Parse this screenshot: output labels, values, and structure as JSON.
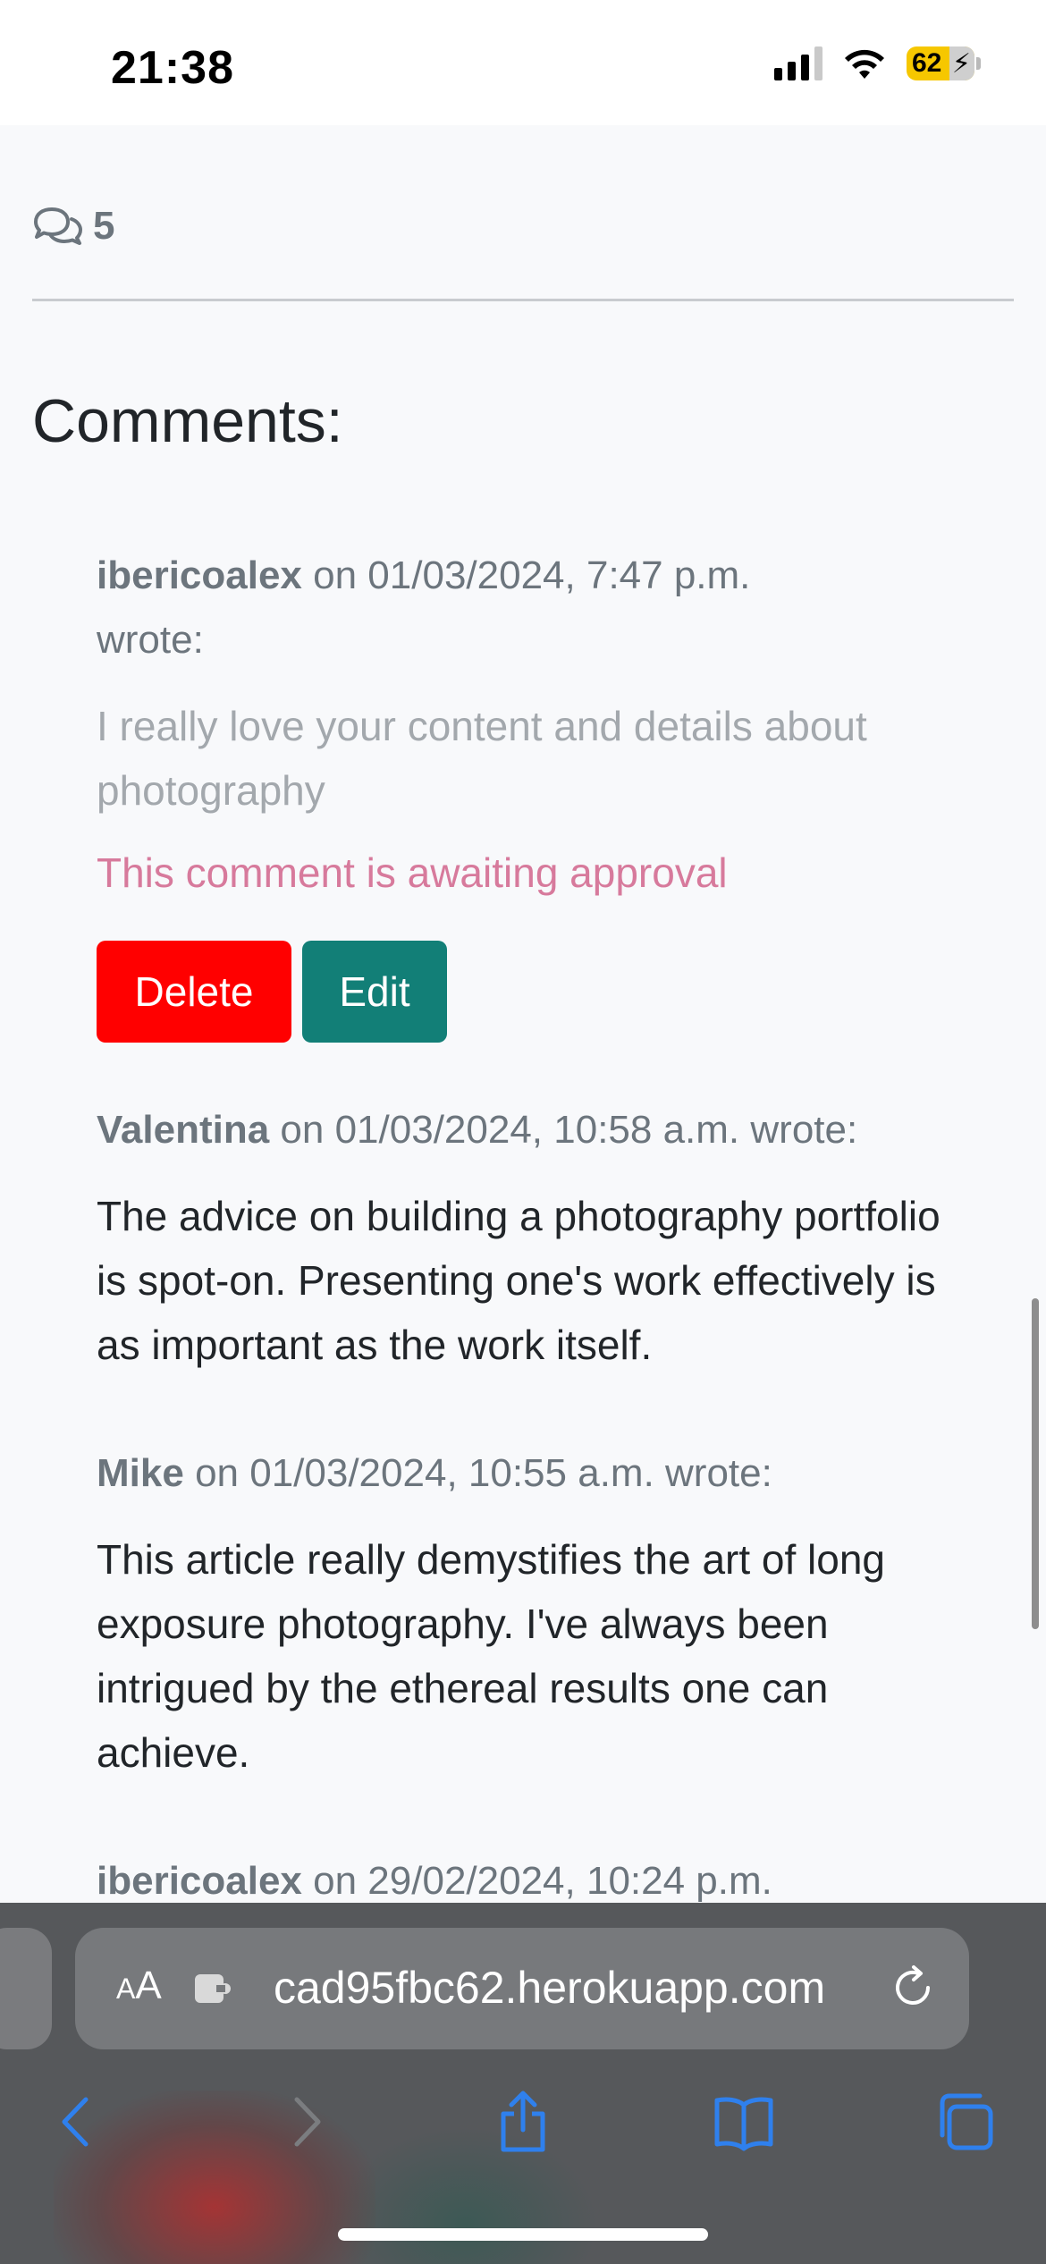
{
  "status_bar": {
    "time": "21:38",
    "battery_percent": "62",
    "battery_level": 0.62
  },
  "post": {
    "comment_count": "5"
  },
  "comments_section": {
    "title": "Comments:",
    "items": [
      {
        "author": "ibericoalex",
        "date_text": "on 01/03/2024, 7:47 p.m.",
        "wrote": "wrote:",
        "body": "I really love your content and details about photography",
        "status": "This comment is awaiting approval",
        "actions": {
          "delete_label": "Delete",
          "edit_label": "Edit"
        }
      },
      {
        "author": "Valentina",
        "date_text": "on 01/03/2024, 10:58 a.m.",
        "wrote": "wrote:",
        "body": "The advice on building a photography portfolio is spot-on. Presenting one's work effectively is as important as the work itself."
      },
      {
        "author": "Mike",
        "date_text": "on 01/03/2024, 10:55 a.m.",
        "wrote": "wrote:",
        "body": "This article really demystifies the art of long exposure photography. I've always been intrigued by the ethereal results one can achieve."
      },
      {
        "author": "ibericoalex",
        "date_text": "on 29/02/2024, 10:24 p.m."
      }
    ]
  },
  "browser": {
    "text_size_label": "A",
    "text_size_label_big": "A",
    "url": "cad95fbc62.herokuapp.com",
    "icons": [
      "back-icon",
      "forward-icon",
      "share-icon",
      "bookmarks-icon",
      "tabs-icon",
      "reload-icon",
      "extension-icon"
    ]
  },
  "colors": {
    "delete": "#ff0000",
    "edit": "#127f77",
    "pending": "#d77a9c",
    "accent": "#2f80ed"
  }
}
